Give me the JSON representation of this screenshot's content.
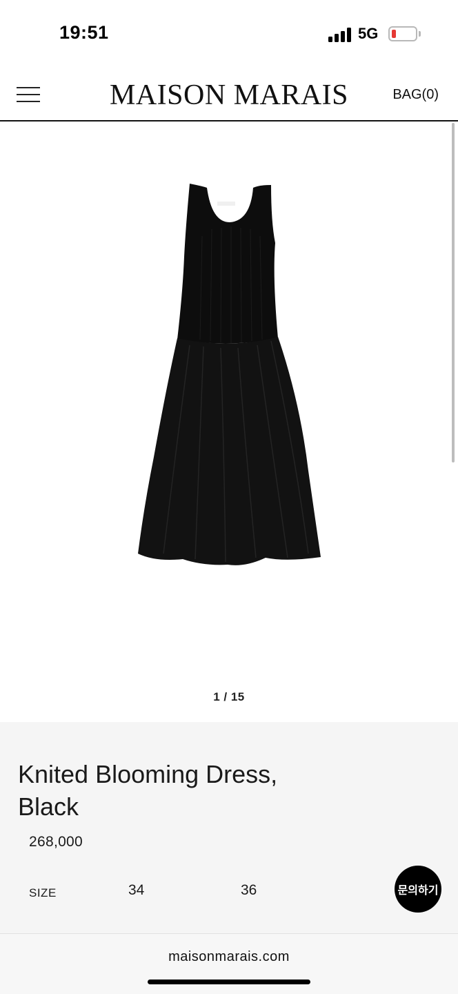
{
  "status_bar": {
    "time": "19:51",
    "network": "5G",
    "battery_color": "#e53935"
  },
  "header": {
    "menu_icon": "hamburger-menu-icon",
    "brand": "MAISON MARAIS",
    "bag_label": "BAG(0)"
  },
  "gallery": {
    "image_alt": "Black sleeveless knit dress with full black skirt",
    "counter": "1 / 15"
  },
  "product": {
    "title": "Knited Blooming Dress, Black",
    "price": "268,000",
    "size_label": "SIZE",
    "sizes": [
      "34",
      "36"
    ]
  },
  "inquiry_button": {
    "label": "문의하기"
  },
  "browser": {
    "url": "maisonmarais.com"
  }
}
